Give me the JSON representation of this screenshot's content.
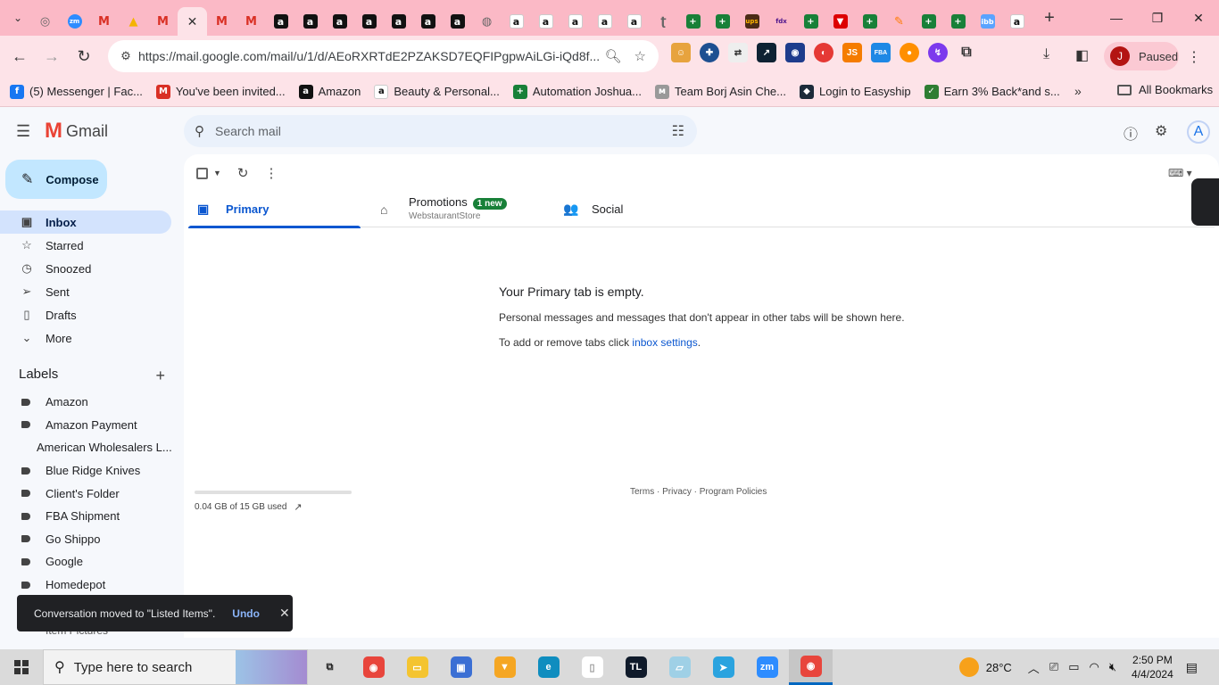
{
  "browser": {
    "tabs": [
      {
        "icon": "chrome-icon",
        "glyph": "◎",
        "cls": "gray"
      },
      {
        "icon": "zoom-icon",
        "glyph": "zm",
        "cls": "zoom"
      },
      {
        "icon": "gmail-icon",
        "glyph": "M",
        "cls": "gmail"
      },
      {
        "icon": "drive-icon",
        "glyph": "▲",
        "cls": "drive"
      },
      {
        "icon": "gmail-icon",
        "glyph": "M",
        "cls": "gmail"
      },
      {
        "icon": "close-icon",
        "glyph": "✕",
        "cls": "active"
      },
      {
        "icon": "gmail-icon",
        "glyph": "M",
        "cls": "gmail"
      },
      {
        "icon": "gmail-icon",
        "glyph": "M",
        "cls": "gmail"
      },
      {
        "icon": "amazon-icon",
        "glyph": "a",
        "cls": "amz"
      },
      {
        "icon": "amazon-icon",
        "glyph": "a",
        "cls": "amz"
      },
      {
        "icon": "amazon-icon",
        "glyph": "a",
        "cls": "amz"
      },
      {
        "icon": "amazon-icon",
        "glyph": "a",
        "cls": "amz"
      },
      {
        "icon": "amazon-icon",
        "glyph": "a",
        "cls": "amz"
      },
      {
        "icon": "amazon-icon",
        "glyph": "a",
        "cls": "amz"
      },
      {
        "icon": "amazon-icon",
        "glyph": "a",
        "cls": "amz"
      },
      {
        "icon": "globe-icon",
        "glyph": "◍",
        "cls": "gray"
      },
      {
        "icon": "amazon-icon",
        "glyph": "a",
        "cls": "amzw"
      },
      {
        "icon": "amazon-icon",
        "glyph": "a",
        "cls": "amzw"
      },
      {
        "icon": "amazon-icon",
        "glyph": "a",
        "cls": "amzw"
      },
      {
        "icon": "amazon-icon",
        "glyph": "a",
        "cls": "amzw"
      },
      {
        "icon": "amazon-icon",
        "glyph": "a",
        "cls": "amzw"
      },
      {
        "icon": "ninja-icon",
        "glyph": "ʈ",
        "cls": "gray"
      },
      {
        "icon": "sheets-icon",
        "glyph": "+",
        "cls": "green"
      },
      {
        "icon": "sheets-icon",
        "glyph": "+",
        "cls": "green"
      },
      {
        "icon": "ups-icon",
        "glyph": "ups",
        "cls": "ups"
      },
      {
        "icon": "fedex-icon",
        "glyph": "fdx",
        "cls": "fedex"
      },
      {
        "icon": "sheets-icon",
        "glyph": "+",
        "cls": "green"
      },
      {
        "icon": "red-logo-icon",
        "glyph": "▼",
        "cls": "red"
      },
      {
        "icon": "sheets-icon",
        "glyph": "+",
        "cls": "green"
      },
      {
        "icon": "pen-icon",
        "glyph": "✎",
        "cls": "pen"
      },
      {
        "icon": "sheets-icon",
        "glyph": "+",
        "cls": "green"
      },
      {
        "icon": "sheets-icon",
        "glyph": "+",
        "cls": "green"
      },
      {
        "icon": "ibb-icon",
        "glyph": "ibb",
        "cls": "ibb"
      },
      {
        "icon": "amazon-icon",
        "glyph": "a",
        "cls": "amzw"
      }
    ],
    "url": "https://mail.google.com/mail/u/1/d/AEoRXRTdE2PZAKSD7EQFIPgpwAiLGi-iQd8f...",
    "profile_initial": "J",
    "profile_status": "Paused",
    "bookmarks": [
      {
        "label": "(5) Messenger | Fac...",
        "icon": "facebook-icon",
        "glyph": "f",
        "color": "#1877f2"
      },
      {
        "label": "You've been invited...",
        "icon": "gmail-icon",
        "glyph": "M",
        "color": "#d93025"
      },
      {
        "label": "Amazon",
        "icon": "amazon-icon",
        "glyph": "a",
        "color": "#111111"
      },
      {
        "label": "Beauty & Personal...",
        "icon": "amazon-icon",
        "glyph": "a",
        "color": "#ffffff"
      },
      {
        "label": "Automation Joshua...",
        "icon": "sheets-icon",
        "glyph": "+",
        "color": "#188038"
      },
      {
        "label": "Team Borj Asin Che...",
        "icon": "logo-icon",
        "glyph": "ᴍ",
        "color": "#999999"
      },
      {
        "label": "Login to Easyship",
        "icon": "easyship-icon",
        "glyph": "◆",
        "color": "#1c2b3a"
      },
      {
        "label": "Earn 3% Back*and s...",
        "icon": "check-icon",
        "glyph": "✓",
        "color": "#2e7d32"
      }
    ],
    "all_bookmarks": "All Bookmarks"
  },
  "gmail": {
    "brand": "Gmail",
    "search_placeholder": "Search mail",
    "compose": "Compose",
    "nav": [
      {
        "label": "Inbox",
        "icon": "inbox-icon",
        "glyph": "▣",
        "active": true
      },
      {
        "label": "Starred",
        "icon": "star-icon",
        "glyph": "☆",
        "active": false
      },
      {
        "label": "Snoozed",
        "icon": "clock-icon",
        "glyph": "◷",
        "active": false
      },
      {
        "label": "Sent",
        "icon": "send-icon",
        "glyph": "➢",
        "active": false
      },
      {
        "label": "Drafts",
        "icon": "draft-icon",
        "glyph": "▯",
        "active": false
      },
      {
        "label": "More",
        "icon": "chevron-down-icon",
        "glyph": "⌄",
        "active": false
      }
    ],
    "labels_title": "Labels",
    "labels": [
      "Amazon",
      "Amazon Payment",
      "American Wholesalers L...",
      "Blue Ridge Knives",
      "Client's Folder",
      "FBA Shipment",
      "Go Shippo",
      "Google",
      "Homedepot"
    ],
    "hidden_label": "Item Pictures",
    "inbox_tabs": [
      {
        "label": "Primary",
        "icon": "inbox-icon",
        "glyph": "▣"
      },
      {
        "label": "Promotions",
        "icon": "tag-icon",
        "glyph": "⌂",
        "badge": "1 new",
        "sub": "WebstaurantStore"
      },
      {
        "label": "Social",
        "icon": "people-icon",
        "glyph": "👥"
      }
    ],
    "empty": {
      "title": "Your Primary tab is empty.",
      "line1": "Personal messages and messages that don't appear in other tabs will be shown here.",
      "line2_prefix": "To add or remove tabs click ",
      "line2_link": "inbox settings",
      "line2_suffix": "."
    },
    "storage": "0.04 GB of 15 GB used",
    "footer": "Terms · Privacy · Program Policies",
    "snackbar": {
      "text": "Conversation moved to \"Listed Items\".",
      "action": "Undo"
    }
  },
  "taskbar": {
    "search_placeholder": "Type here to search",
    "apps": [
      {
        "icon": "task-view-icon",
        "glyph": "⧉",
        "color": "transparent",
        "fg": "#222"
      },
      {
        "icon": "chrome-icon",
        "glyph": "◉",
        "color": "#e8453c",
        "fg": "#fff"
      },
      {
        "icon": "file-explorer-icon",
        "glyph": "▭",
        "color": "#f4c430",
        "fg": "#fff"
      },
      {
        "icon": "app-icon",
        "glyph": "▣",
        "color": "#3b6fd4",
        "fg": "#fff"
      },
      {
        "icon": "brave-icon",
        "glyph": "▼",
        "color": "#f5a623",
        "fg": "#fff"
      },
      {
        "icon": "edge-icon",
        "glyph": "e",
        "color": "#0f8dbf",
        "fg": "#fff"
      },
      {
        "icon": "notepad-icon",
        "glyph": "▯",
        "color": "#ffffff",
        "fg": "#999"
      },
      {
        "icon": "tl-icon",
        "glyph": "TL",
        "color": "#0f1a2a",
        "fg": "#fff"
      },
      {
        "icon": "paper-icon",
        "glyph": "▱",
        "color": "#9fd0e6",
        "fg": "#fff"
      },
      {
        "icon": "telegram-icon",
        "glyph": "➤",
        "color": "#2aa3df",
        "fg": "#fff"
      },
      {
        "icon": "zoom-icon",
        "glyph": "zm",
        "color": "#2d8cff",
        "fg": "#fff"
      },
      {
        "icon": "chrome-icon",
        "glyph": "◉",
        "color": "#e8453c",
        "fg": "#fff",
        "active": true
      }
    ],
    "temperature": "28°C",
    "time": "2:50 PM",
    "date": "4/4/2024"
  }
}
